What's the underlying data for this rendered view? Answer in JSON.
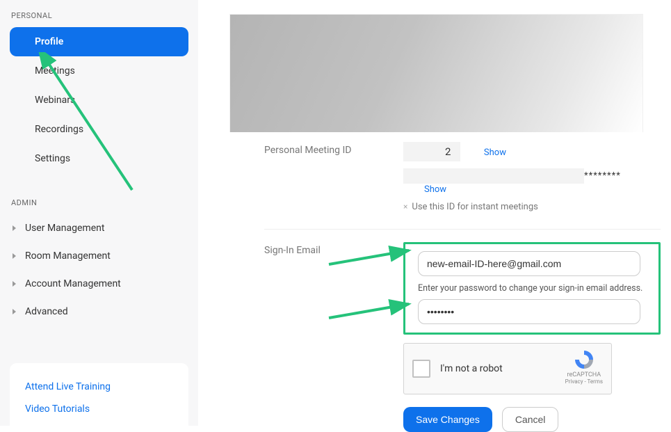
{
  "sidebar": {
    "personal_heading": "PERSONAL",
    "items": [
      {
        "label": "Profile",
        "active": true
      },
      {
        "label": "Meetings"
      },
      {
        "label": "Webinars"
      },
      {
        "label": "Recordings"
      },
      {
        "label": "Settings"
      }
    ],
    "admin_heading": "ADMIN",
    "admin_items": [
      {
        "label": "User Management"
      },
      {
        "label": "Room Management"
      },
      {
        "label": "Account Management"
      },
      {
        "label": "Advanced"
      }
    ],
    "bottom_links": [
      {
        "label": "Attend Live Training"
      },
      {
        "label": "Video Tutorials"
      }
    ]
  },
  "profile": {
    "pmi": {
      "label": "Personal Meeting ID",
      "masked_value": "2",
      "show": "Show",
      "asterisks": "********",
      "show2": "Show",
      "instant_x": "×",
      "instant_text": "Use this ID for instant meetings"
    },
    "signin": {
      "label": "Sign-In Email",
      "email_value": "new-email-ID-here@gmail.com",
      "hint": "Enter your password to change your sign-in email address.",
      "password_value": "••••••••"
    },
    "recaptcha": {
      "label": "I'm not a robot",
      "brand": "reCAPTCHA",
      "terms": "Privacy - Terms"
    },
    "actions": {
      "save": "Save Changes",
      "cancel": "Cancel"
    }
  }
}
